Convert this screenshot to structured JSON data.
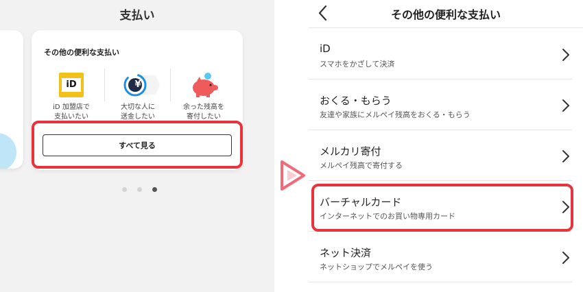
{
  "left": {
    "title": "支払い",
    "card": {
      "title": "その他の便利な支払い",
      "items": [
        {
          "icon": "id-logo-icon",
          "icon_text": "iD",
          "label": "iD 加盟店で\n支払いたい"
        },
        {
          "icon": "yen-transfer-icon",
          "icon_text": "¥",
          "label": "大切な人に\n送金したい"
        },
        {
          "icon": "piggy-bank-icon",
          "label": "余った残高を\n寄付したい"
        }
      ],
      "see_all_label": "すべて見る"
    },
    "pagination": {
      "count": 3,
      "active": 3
    }
  },
  "right": {
    "title": "その他の便利な支払い",
    "items": [
      {
        "title": "iD",
        "subtitle": "スマホをかざして決済"
      },
      {
        "title": "おくる・もらう",
        "subtitle": "友達や家族にメルペイ残高をおくる・もらう"
      },
      {
        "title": "メルカリ寄付",
        "subtitle": "メルペイ残高で寄付する"
      },
      {
        "title": "バーチャルカード",
        "subtitle": "インターネットでのお買い物専用カード"
      },
      {
        "title": "ネット決済",
        "subtitle": "ネットショップでメルペイを使う"
      }
    ]
  },
  "colors": {
    "highlight": "#e8323c",
    "arrow": "#f06a78",
    "id_yellow": "#f2c11a",
    "yen_blue": "#1d8fe1",
    "piggy_red": "#ef5b5b"
  }
}
